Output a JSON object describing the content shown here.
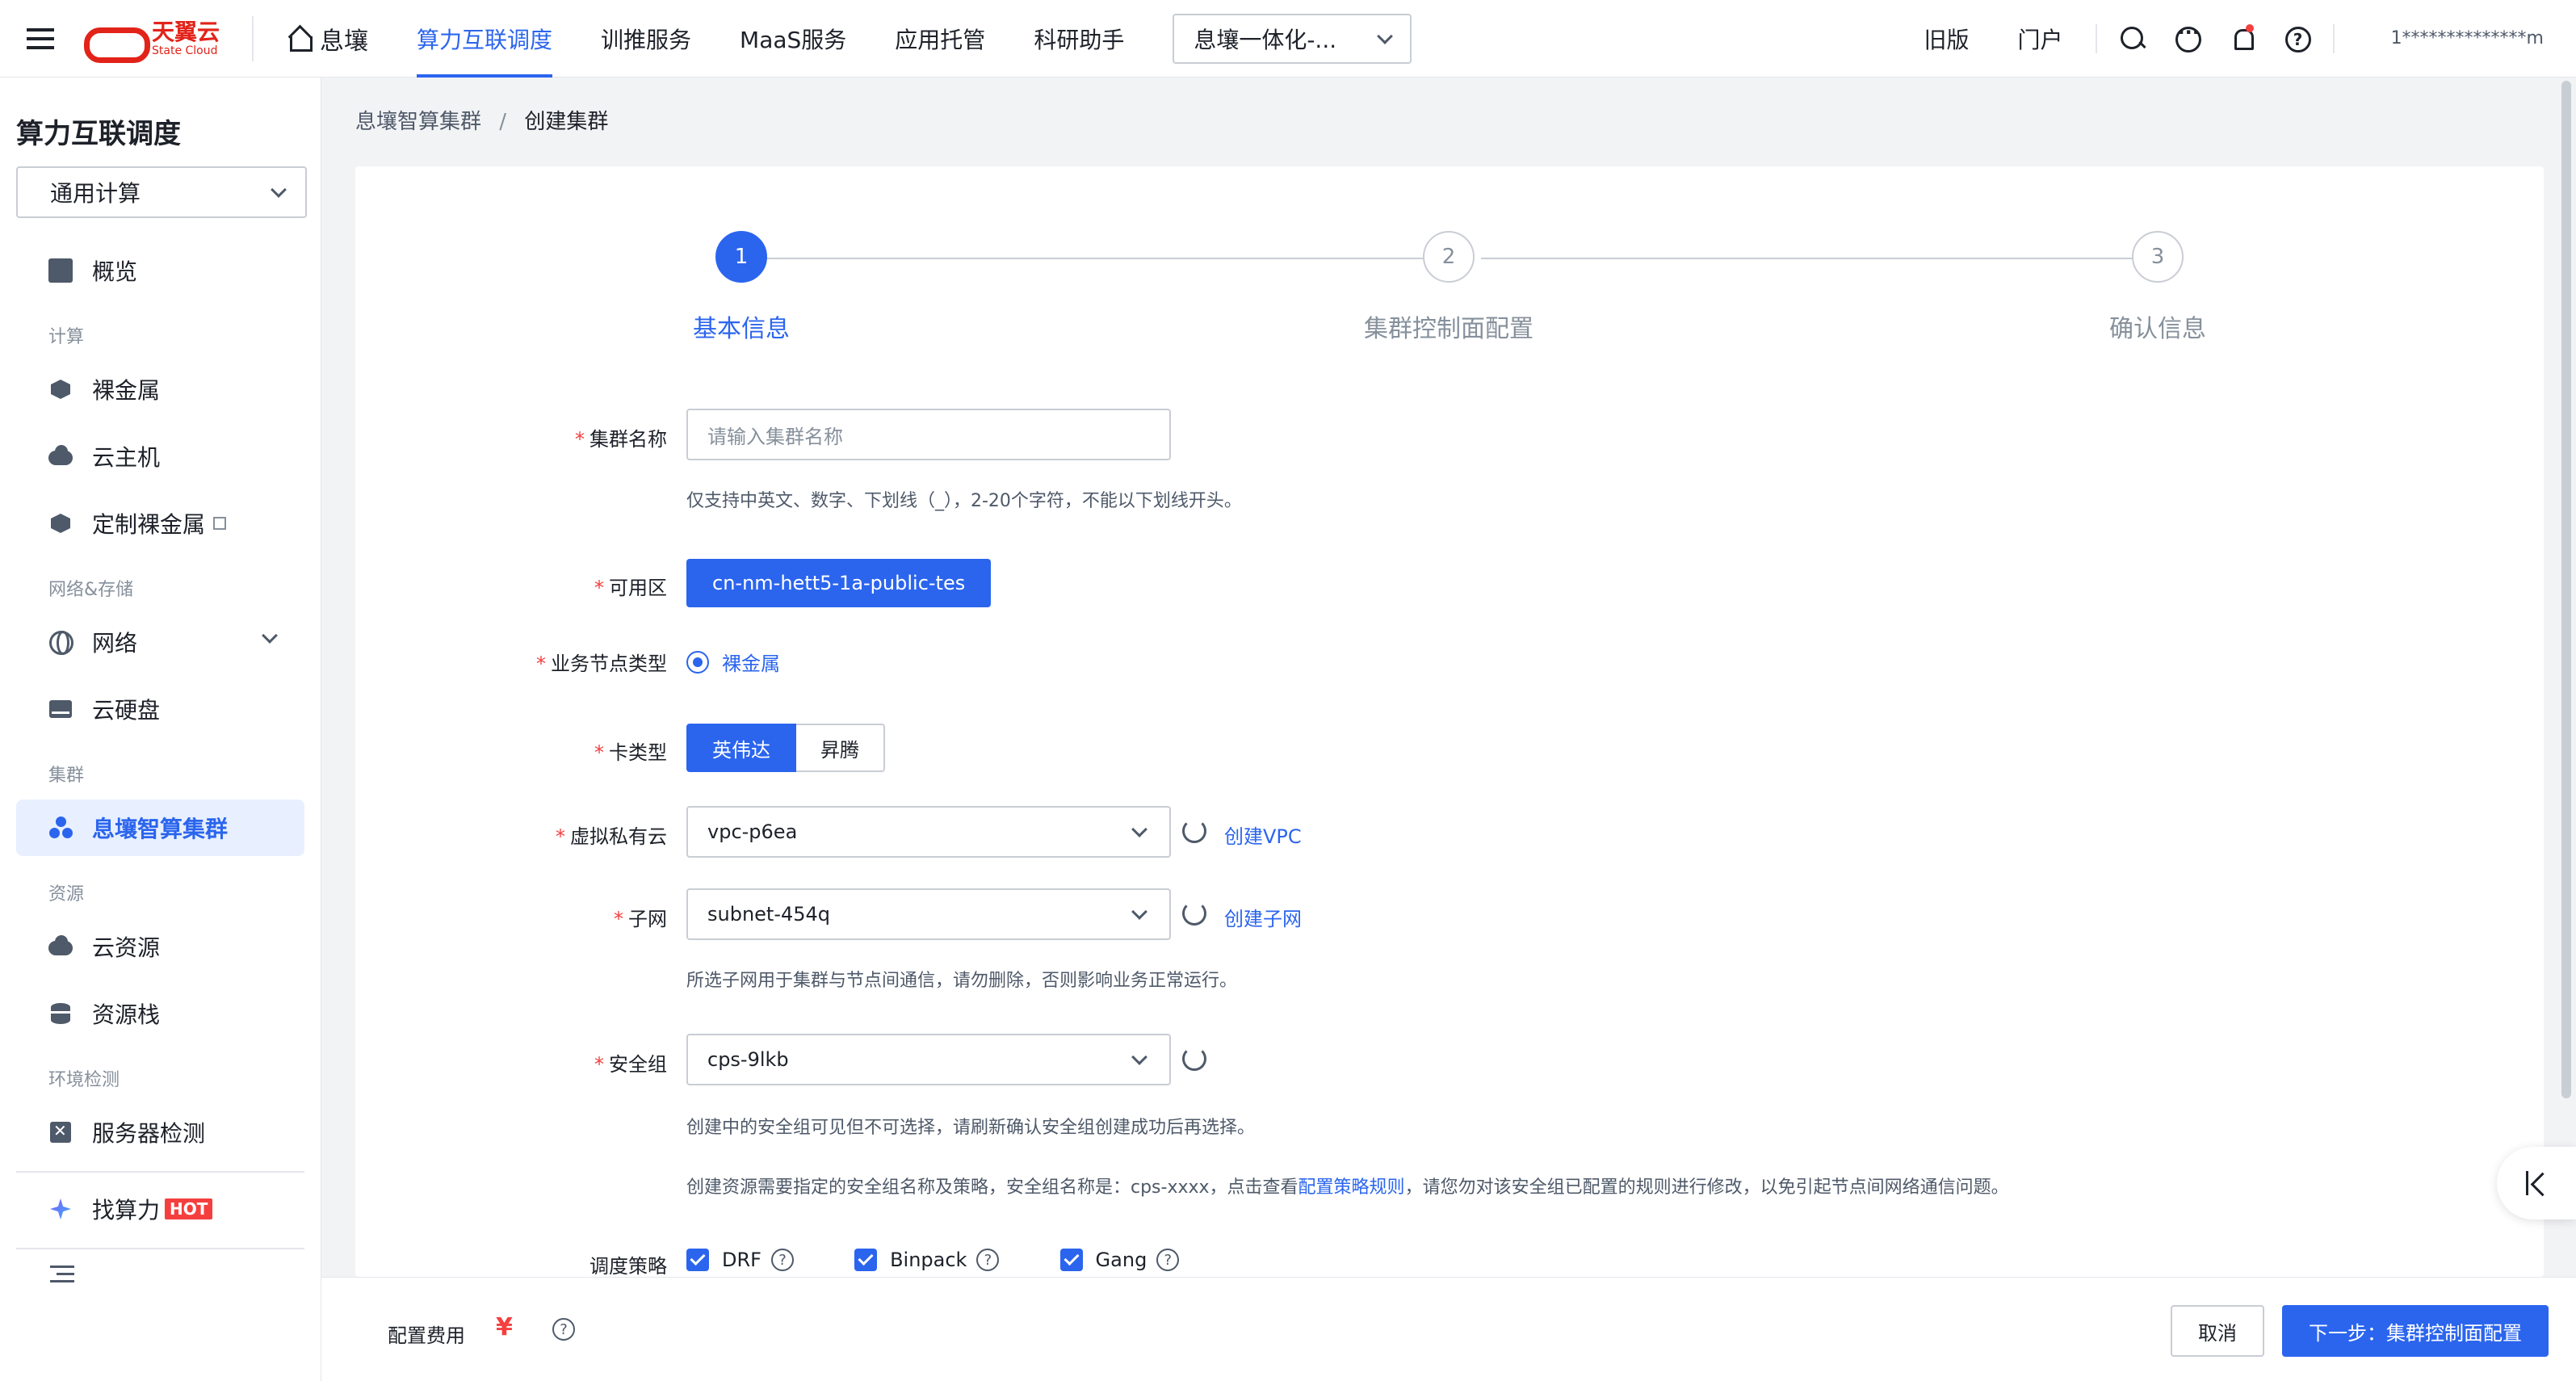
{
  "topbar": {
    "logo_cn": "天翼云",
    "logo_en": "State Cloud",
    "nav": [
      {
        "label": "息壤",
        "icon": "home-icon"
      },
      {
        "label": "算力互联调度",
        "active": true
      },
      {
        "label": "训推服务"
      },
      {
        "label": "MaaS服务"
      },
      {
        "label": "应用托管"
      },
      {
        "label": "科研助手"
      }
    ],
    "workspace": "息壤一体化-...",
    "old_version": "旧版",
    "portal": "门户",
    "user": "1**************m",
    "icons": [
      "search-icon",
      "more-icon",
      "bell-icon",
      "help-icon"
    ]
  },
  "sidebar": {
    "title": "算力互联调度",
    "select_value": "通用计算",
    "overview": "概览",
    "groups": {
      "compute": "计算",
      "network_storage": "网络&存储",
      "cluster": "集群",
      "resource": "资源",
      "env_check": "环境检测"
    },
    "items": {
      "baremetal": "裸金属",
      "vm": "云主机",
      "custom_baremetal": "定制裸金属",
      "network": "网络",
      "disk": "云硬盘",
      "cluster": "息壤智算集群",
      "cloud_resource": "云资源",
      "resource_stack": "资源栈",
      "server_check": "服务器检测",
      "find_compute": "找算力",
      "hot": "HOT"
    }
  },
  "breadcrumb": {
    "parent": "息壤智算集群",
    "separator": "/",
    "current": "创建集群"
  },
  "steps": [
    {
      "num": "1",
      "label": "基本信息",
      "active": true
    },
    {
      "num": "2",
      "label": "集群控制面配置"
    },
    {
      "num": "3",
      "label": "确认信息"
    }
  ],
  "form": {
    "cluster_name": {
      "label": "集群名称",
      "placeholder": "请输入集群名称",
      "hint": "仅支持中英文、数字、下划线（_），2-20个字符，不能以下划线开头。"
    },
    "zone": {
      "label": "可用区",
      "value": "cn-nm-hett5-1a-public-tes"
    },
    "node_type": {
      "label": "业务节点类型",
      "value": "裸金属"
    },
    "card_type": {
      "label": "卡类型",
      "options": [
        "英伟达",
        "昇腾"
      ]
    },
    "vpc": {
      "label": "虚拟私有云",
      "value": "vpc-p6ea",
      "create_link": "创建VPC"
    },
    "subnet": {
      "label": "子网",
      "value": "subnet-454q",
      "create_link": "创建子网",
      "hint": "所选子网用于集群与节点间通信，请勿删除，否则影响业务正常运行。"
    },
    "security_group": {
      "label": "安全组",
      "value": "cps-9lkb",
      "hint1": "创建中的安全组可见但不可选择，请刷新确认安全组创建成功后再选择。",
      "hint2_pre": "创建资源需要指定的安全组名称及策略，安全组名称是：cps-xxxx，点击查看",
      "hint2_link": "配置策略规则",
      "hint2_post": "，请您勿对该安全组已配置的规则进行修改，以免引起节点间网络通信问题。"
    },
    "scheduling": {
      "label": "调度策略",
      "options": [
        "DRF",
        "Binpack",
        "Gang"
      ]
    }
  },
  "footer": {
    "fee_label": "配置费用",
    "fee_value": "¥",
    "cancel": "取消",
    "next": "下一步：集群控制面配置"
  }
}
